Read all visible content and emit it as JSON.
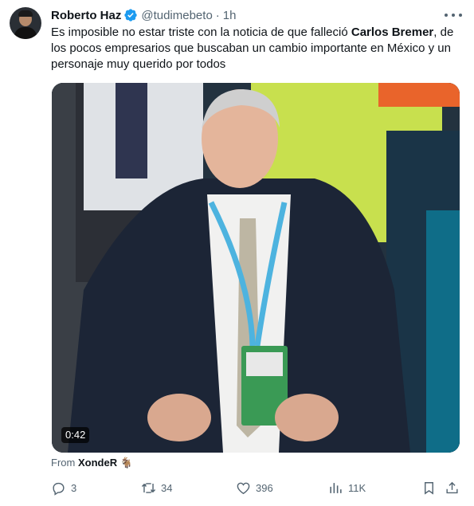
{
  "tweet": {
    "author_name": "Roberto Haz",
    "handle": "@tudimebeto",
    "separator": "·",
    "time": "1h",
    "text_part1": "Es imposible no estar triste con la noticia de que falleció ",
    "text_bold": "Carlos Bremer",
    "text_part2": ", de los pocos empresarios que buscaban un cambio importante en México y un personaje muy querido por todos",
    "video_duration": "0:42",
    "from_label": "From",
    "from_name": "XondeR",
    "from_emoji": "🐐",
    "icons": {
      "verified": "verified-badge-icon",
      "more": "more-icon",
      "reply": "reply-icon",
      "retweet": "retweet-icon",
      "like": "heart-icon",
      "views": "views-icon",
      "bookmark": "bookmark-icon",
      "share": "share-icon"
    },
    "accent_color": "#1d9bf0"
  },
  "actions": {
    "replies": "3",
    "retweets": "34",
    "likes": "396",
    "views": "11K"
  }
}
